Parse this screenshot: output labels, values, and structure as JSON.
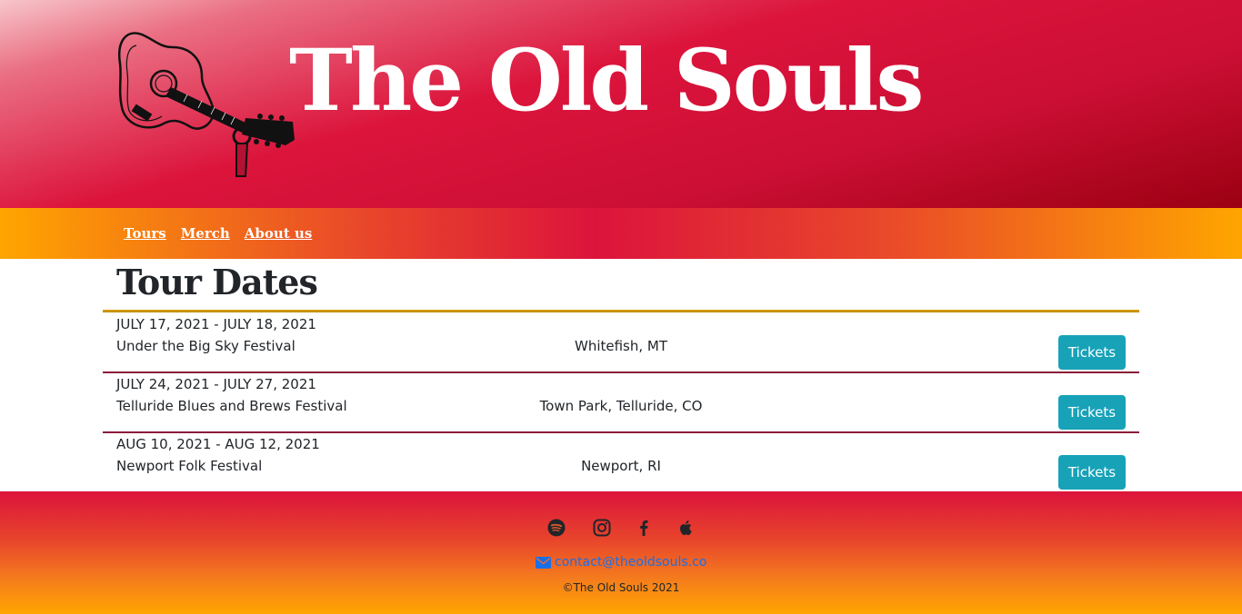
{
  "header": {
    "band_name": "The Old Souls",
    "logo_icon": "guitar-icon"
  },
  "nav": {
    "items": [
      {
        "label": "Tours"
      },
      {
        "label": "Merch"
      },
      {
        "label": "About us"
      }
    ]
  },
  "tour": {
    "title": "Tour Dates",
    "dates": [
      {
        "date": "JULY 17, 2021 - JULY 18, 2021",
        "event": "Under the Big Sky Festival",
        "venue": "Whitefish, MT",
        "button": "Tickets"
      },
      {
        "date": "JULY 24, 2021 - JULY 27, 2021",
        "event": "Telluride Blues and Brews Festival",
        "venue": "Town Park, Telluride, CO",
        "button": "Tickets"
      },
      {
        "date": "AUG 10, 2021 - AUG 12, 2021",
        "event": "Newport Folk Festival",
        "venue": "Newport, RI",
        "button": "Tickets"
      }
    ]
  },
  "footer": {
    "social_icons": [
      "spotify-icon",
      "instagram-icon",
      "facebook-icon",
      "apple-icon"
    ],
    "email_icon": "envelope-icon",
    "email": "contact@theoldsouls.co",
    "copyright": "©The Old Souls 2021"
  },
  "colors": {
    "header": "#dc143c",
    "nav_accent": "#ffa500",
    "button": "#17a2b8",
    "link": "#1a6fe8",
    "divider": "#8b1c3a"
  }
}
